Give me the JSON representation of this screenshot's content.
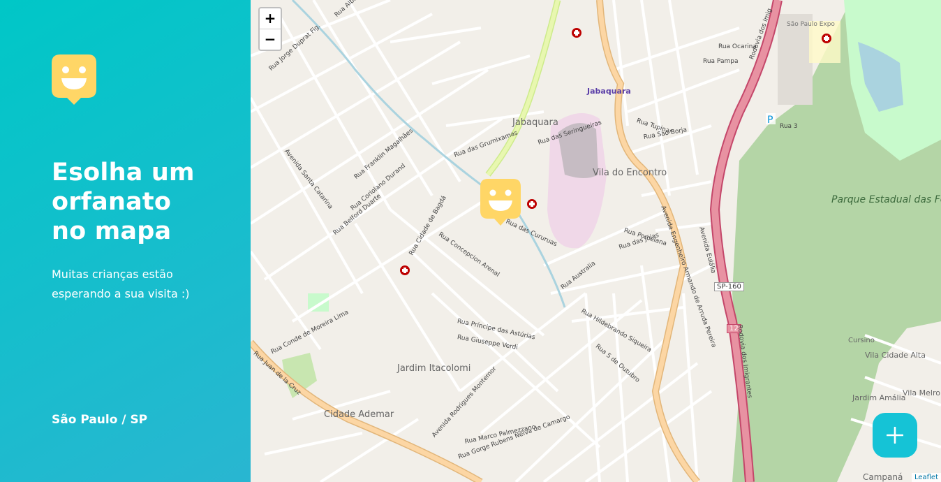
{
  "sidebar": {
    "title": "Esolha um orfanato no mapa",
    "subtitle": "Muitas crianças estão esperando a sua visita :)",
    "location": "São Paulo / SP",
    "logo_icon": "smiley-logo-icon"
  },
  "map": {
    "zoom_in": "+",
    "zoom_out": "−",
    "attribution": "Leaflet",
    "districts": {
      "jabaquara": "Jabaquara",
      "vila_encontro": "Vila do Encontro",
      "jardim_itacolomi": "Jardim Itacolomi",
      "cidade_ademar": "Cidade Ademar",
      "vila_cidade_alta": "Vila Cidade Alta",
      "jardim_amalia": "Jardim Amália",
      "vila_melro": "Vila Melro",
      "cursino": "Cursino",
      "campanha": "Campaná"
    },
    "station": "Jabaquara",
    "expo": "São Paulo Expo",
    "park": "Parque Estadual das Fontes do Ipiranga",
    "shields": {
      "sp160": "SP-160",
      "r12": "12"
    },
    "streets": {
      "imigrantes": "Rodovia dos Imigrantes",
      "armando": "Avenida Engenheiro Armando de Arruda Pereira",
      "santa_catarina": "Avenida Santa Catarina",
      "cidade_bagda": "Rua Cidade de Bagdá",
      "coriolano": "Rua Coriolano Durand",
      "juan_cruz": "Rua Juan de la Cruz",
      "rodrigues_montemor": "Avenida Rodrigues Montemor",
      "conde_moreira": "Rua Conde de Moreira Lima",
      "eulalia": "Avenida Eulália",
      "franklin": "Rua Franklin Magalhães",
      "belford": "Rua Belford Duarte",
      "cururuas": "Rua das Cururuas",
      "tupinar": "Rua Tupinar",
      "sao_borja": "Rua São Borja",
      "ocarina": "Rua Ocarina",
      "pampa": "Rua Pampa",
      "seringueiras": "Rua das Seringueiras",
      "grumixamas": "Rua das Grumixamas",
      "concepcion": "Rua Concepcion Arenal",
      "principe": "Rua Príncipe das Astúrias",
      "giuseppe": "Rua Giuseppe Verdi",
      "porcelana": "Rua Porcelana",
      "joias": "Rua das Jóias",
      "australia": "Rua Australia",
      "hildebrando": "Rua Hildebrando Siqueira",
      "cinco_outubro": "Rua 5 de Outubro",
      "camargo": "Rua Gorge Rubens Neiva de Camargo",
      "palmezzano": "Rua Marco Palmezzano",
      "alba": "Rua Alba",
      "jorge_duprat": "Rua Jorge Duprat Fig.",
      "rua3": "Rua 3",
      "imigr_top": "Rodovia dos Imig"
    }
  },
  "colors": {
    "sidebar_start": "#29B6D1",
    "sidebar_end": "#00C7C7",
    "accent": "#15C3D6",
    "marker": "#FFD666"
  },
  "actions": {
    "add_icon": "plus-icon"
  }
}
